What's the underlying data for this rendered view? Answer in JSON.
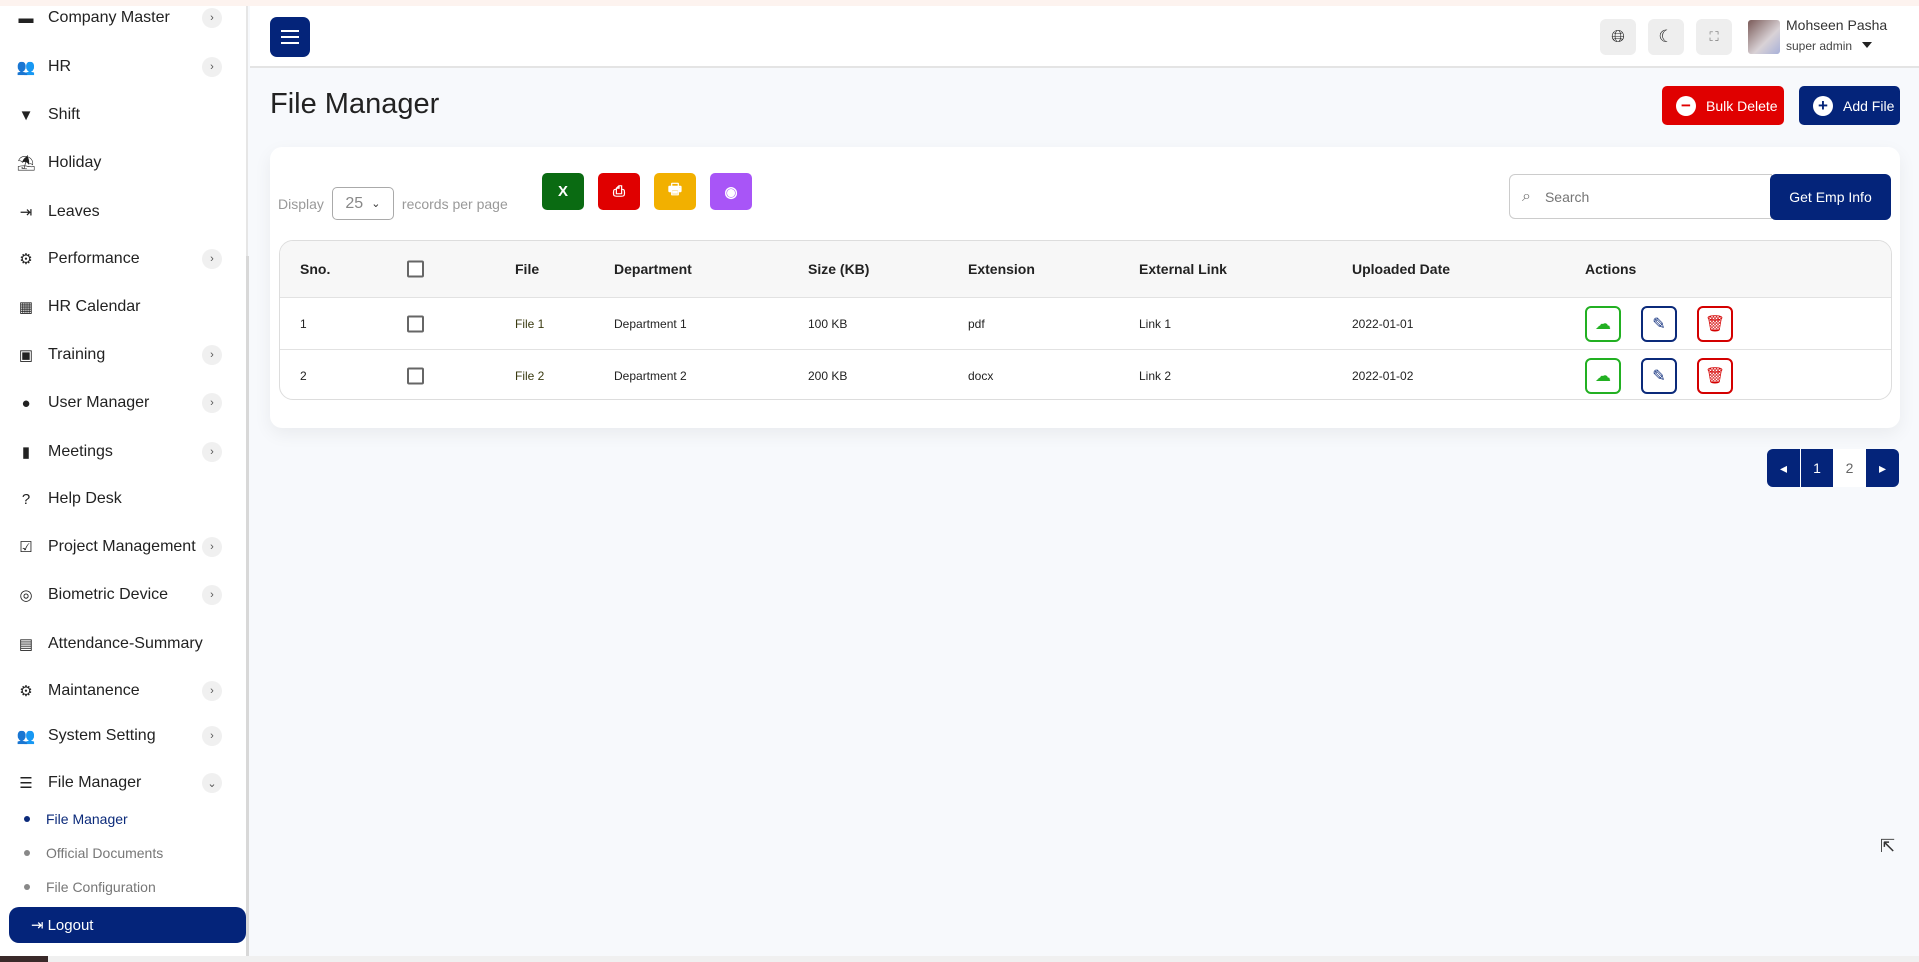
{
  "sidebar": {
    "items": [
      {
        "label": "Company Master",
        "icon": "server-icon",
        "glyph": "▬",
        "chevron": "›"
      },
      {
        "label": "HR",
        "icon": "users-icon",
        "glyph": "👥",
        "chevron": "›"
      },
      {
        "label": "Shift",
        "icon": "filter-icon",
        "glyph": "▼"
      },
      {
        "label": "Holiday",
        "icon": "umbrella-beach-icon",
        "glyph": "⛱"
      },
      {
        "label": "Leaves",
        "icon": "sign-out-icon",
        "glyph": "⇥"
      },
      {
        "label": "Performance",
        "icon": "gears-icon",
        "glyph": "⚙",
        "chevron": "›"
      },
      {
        "label": "HR Calendar",
        "icon": "calendar-icon",
        "glyph": "▦"
      },
      {
        "label": "Training",
        "icon": "chalkboard-user-icon",
        "glyph": "▣",
        "chevron": "›"
      },
      {
        "label": "User Manager",
        "icon": "user-icon",
        "glyph": "●",
        "chevron": "›"
      },
      {
        "label": "Meetings",
        "icon": "door-icon",
        "glyph": "▮",
        "chevron": "›"
      },
      {
        "label": "Help Desk",
        "icon": "question-circle-icon",
        "glyph": "?"
      },
      {
        "label": "Project Management",
        "icon": "check-square-icon",
        "glyph": "☑",
        "chevron": "›"
      },
      {
        "label": "Biometric Device",
        "icon": "fingerprint-icon",
        "glyph": "◎",
        "chevron": "›"
      },
      {
        "label": "Attendance-Summary",
        "icon": "id-badge-icon",
        "glyph": "▤"
      },
      {
        "label": "Maintanence",
        "icon": "user-gear-icon",
        "glyph": "⚙",
        "chevron": "›"
      },
      {
        "label": "System Setting",
        "icon": "user-group-icon",
        "glyph": "👥",
        "chevron": "›"
      },
      {
        "label": "File Manager",
        "icon": "list-check-icon",
        "glyph": "☰",
        "chevron": "⌄"
      }
    ],
    "sub_items": [
      {
        "label": "File Manager",
        "active": true
      },
      {
        "label": "Official Documents"
      },
      {
        "label": "File Configuration"
      }
    ],
    "logout_label": "Logout"
  },
  "header": {
    "user_name": "Mohseen Pasha",
    "user_role": "super admin"
  },
  "page": {
    "title": "File Manager",
    "bulk_delete_label": "Bulk Delete",
    "add_file_label": "Add File"
  },
  "toolbar": {
    "display_label": "Display",
    "per_page": "25",
    "records_label": "records per page",
    "search_placeholder": "Search",
    "get_emp_info_label": "Get Emp Info",
    "colors": {
      "excel": "#0a6b12",
      "pdf": "#e00000",
      "print": "#f2b000",
      "view": "#a855f7",
      "primary": "#04247a",
      "danger": "#e00000"
    }
  },
  "table": {
    "columns": [
      "Sno.",
      "",
      "File",
      "Department",
      "Size (KB)",
      "Extension",
      "External Link",
      "Uploaded Date",
      "Actions"
    ],
    "rows": [
      {
        "sno": "1",
        "file": "File 1",
        "department": "Department 1",
        "size": "100 KB",
        "extension": "pdf",
        "link": "Link 1",
        "date": "2022-01-01"
      },
      {
        "sno": "2",
        "file": "File 2",
        "department": "Department 2",
        "size": "200 KB",
        "extension": "docx",
        "link": "Link 2",
        "date": "2022-01-02"
      }
    ]
  },
  "pagination": {
    "pages": [
      "1",
      "2"
    ],
    "current": "1"
  }
}
